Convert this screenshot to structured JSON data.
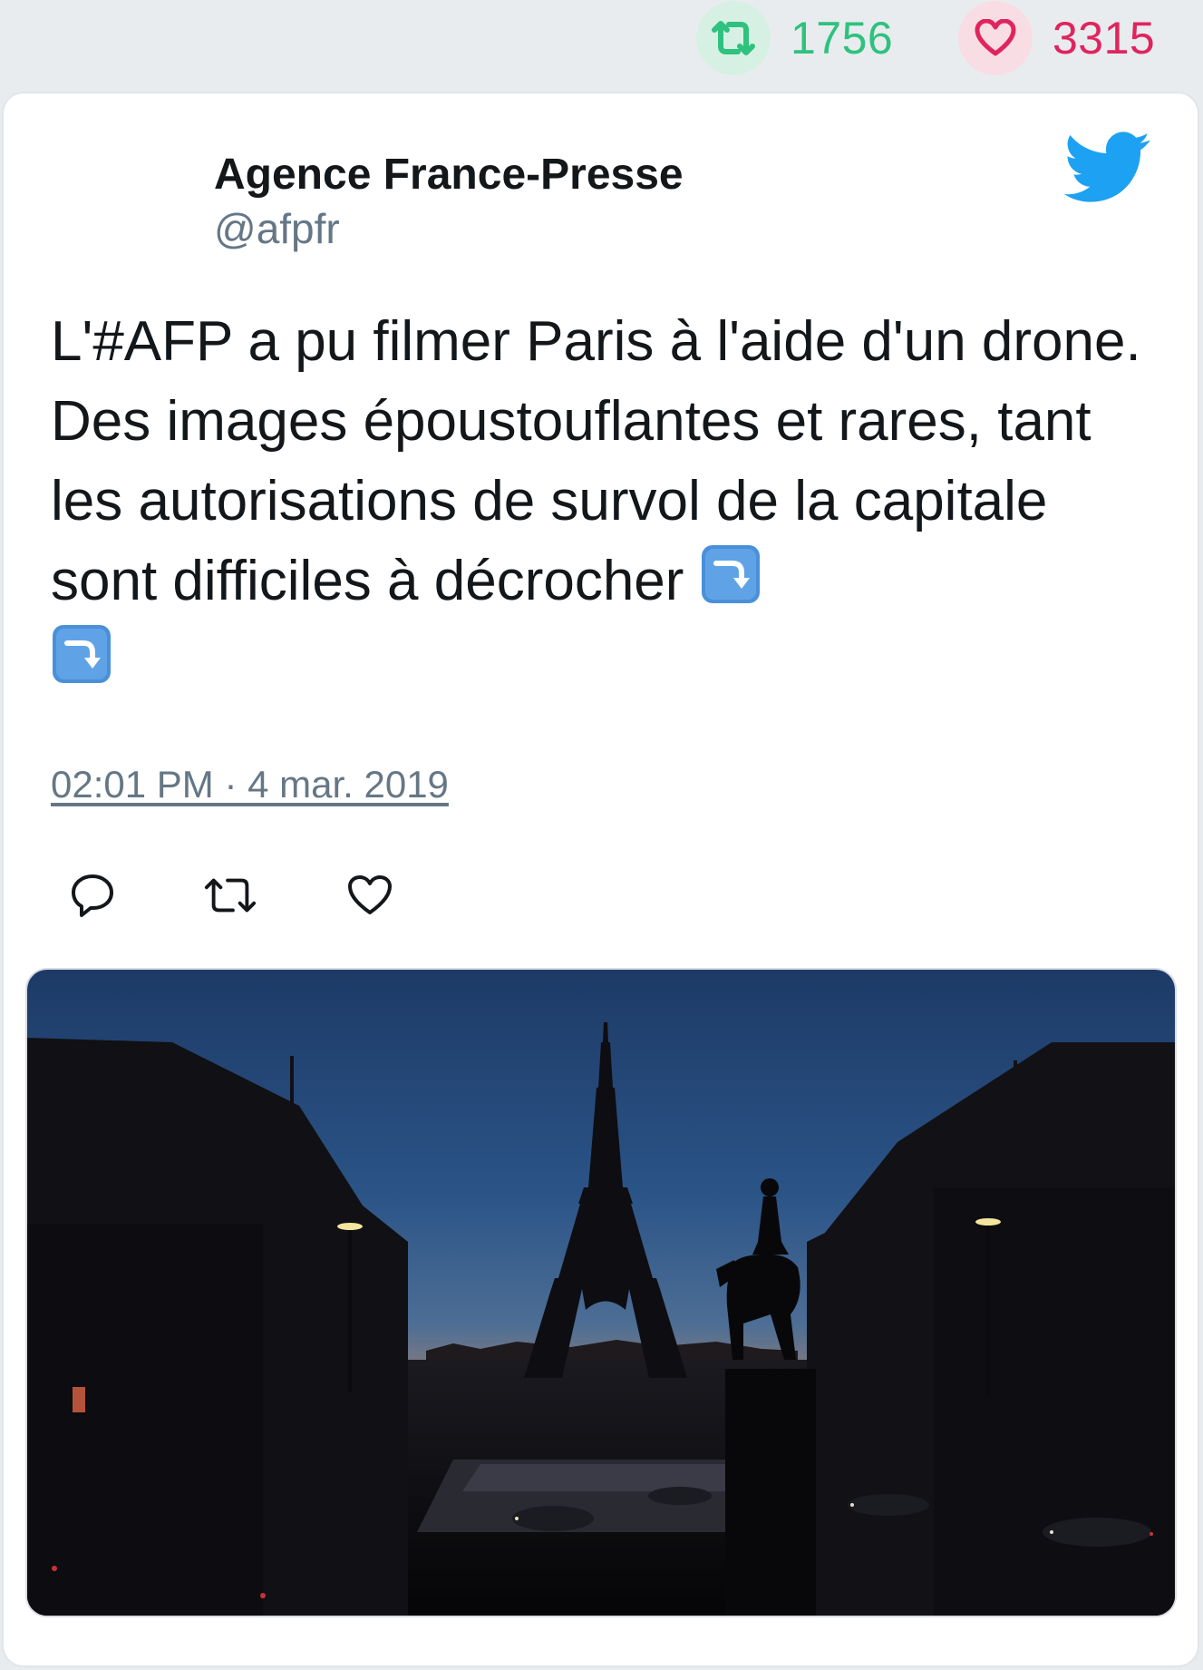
{
  "stats": {
    "retweets": "1756",
    "likes": "3315",
    "retweet_color": "#2ec27e",
    "like_color": "#e0245e"
  },
  "tweet": {
    "author_name": "Agence France-Presse",
    "author_handle": "@afpfr",
    "text": "L'#AFP a pu filmer Paris à l'aide d'un drone. Des images époustouflantes et rares, tant les autorisations de survol de la capitale sont difficiles à décrocher",
    "timestamp": "02:01 PM · 4 mar. 2019",
    "emojis": [
      "arrow-curving-down-emoji",
      "arrow-curving-down-emoji"
    ],
    "media_description_icon": "eiffel-tower-dusk-photo"
  },
  "icons": {
    "retweet_stat": "retweet-icon",
    "like_stat": "heart-icon",
    "brand": "twitter-bird-icon",
    "reply": "reply-icon",
    "retweet": "retweet-icon",
    "like": "heart-icon"
  },
  "colors": {
    "twitter_blue": "#1da1f2",
    "text_primary": "#14171a",
    "text_secondary": "#657786"
  }
}
